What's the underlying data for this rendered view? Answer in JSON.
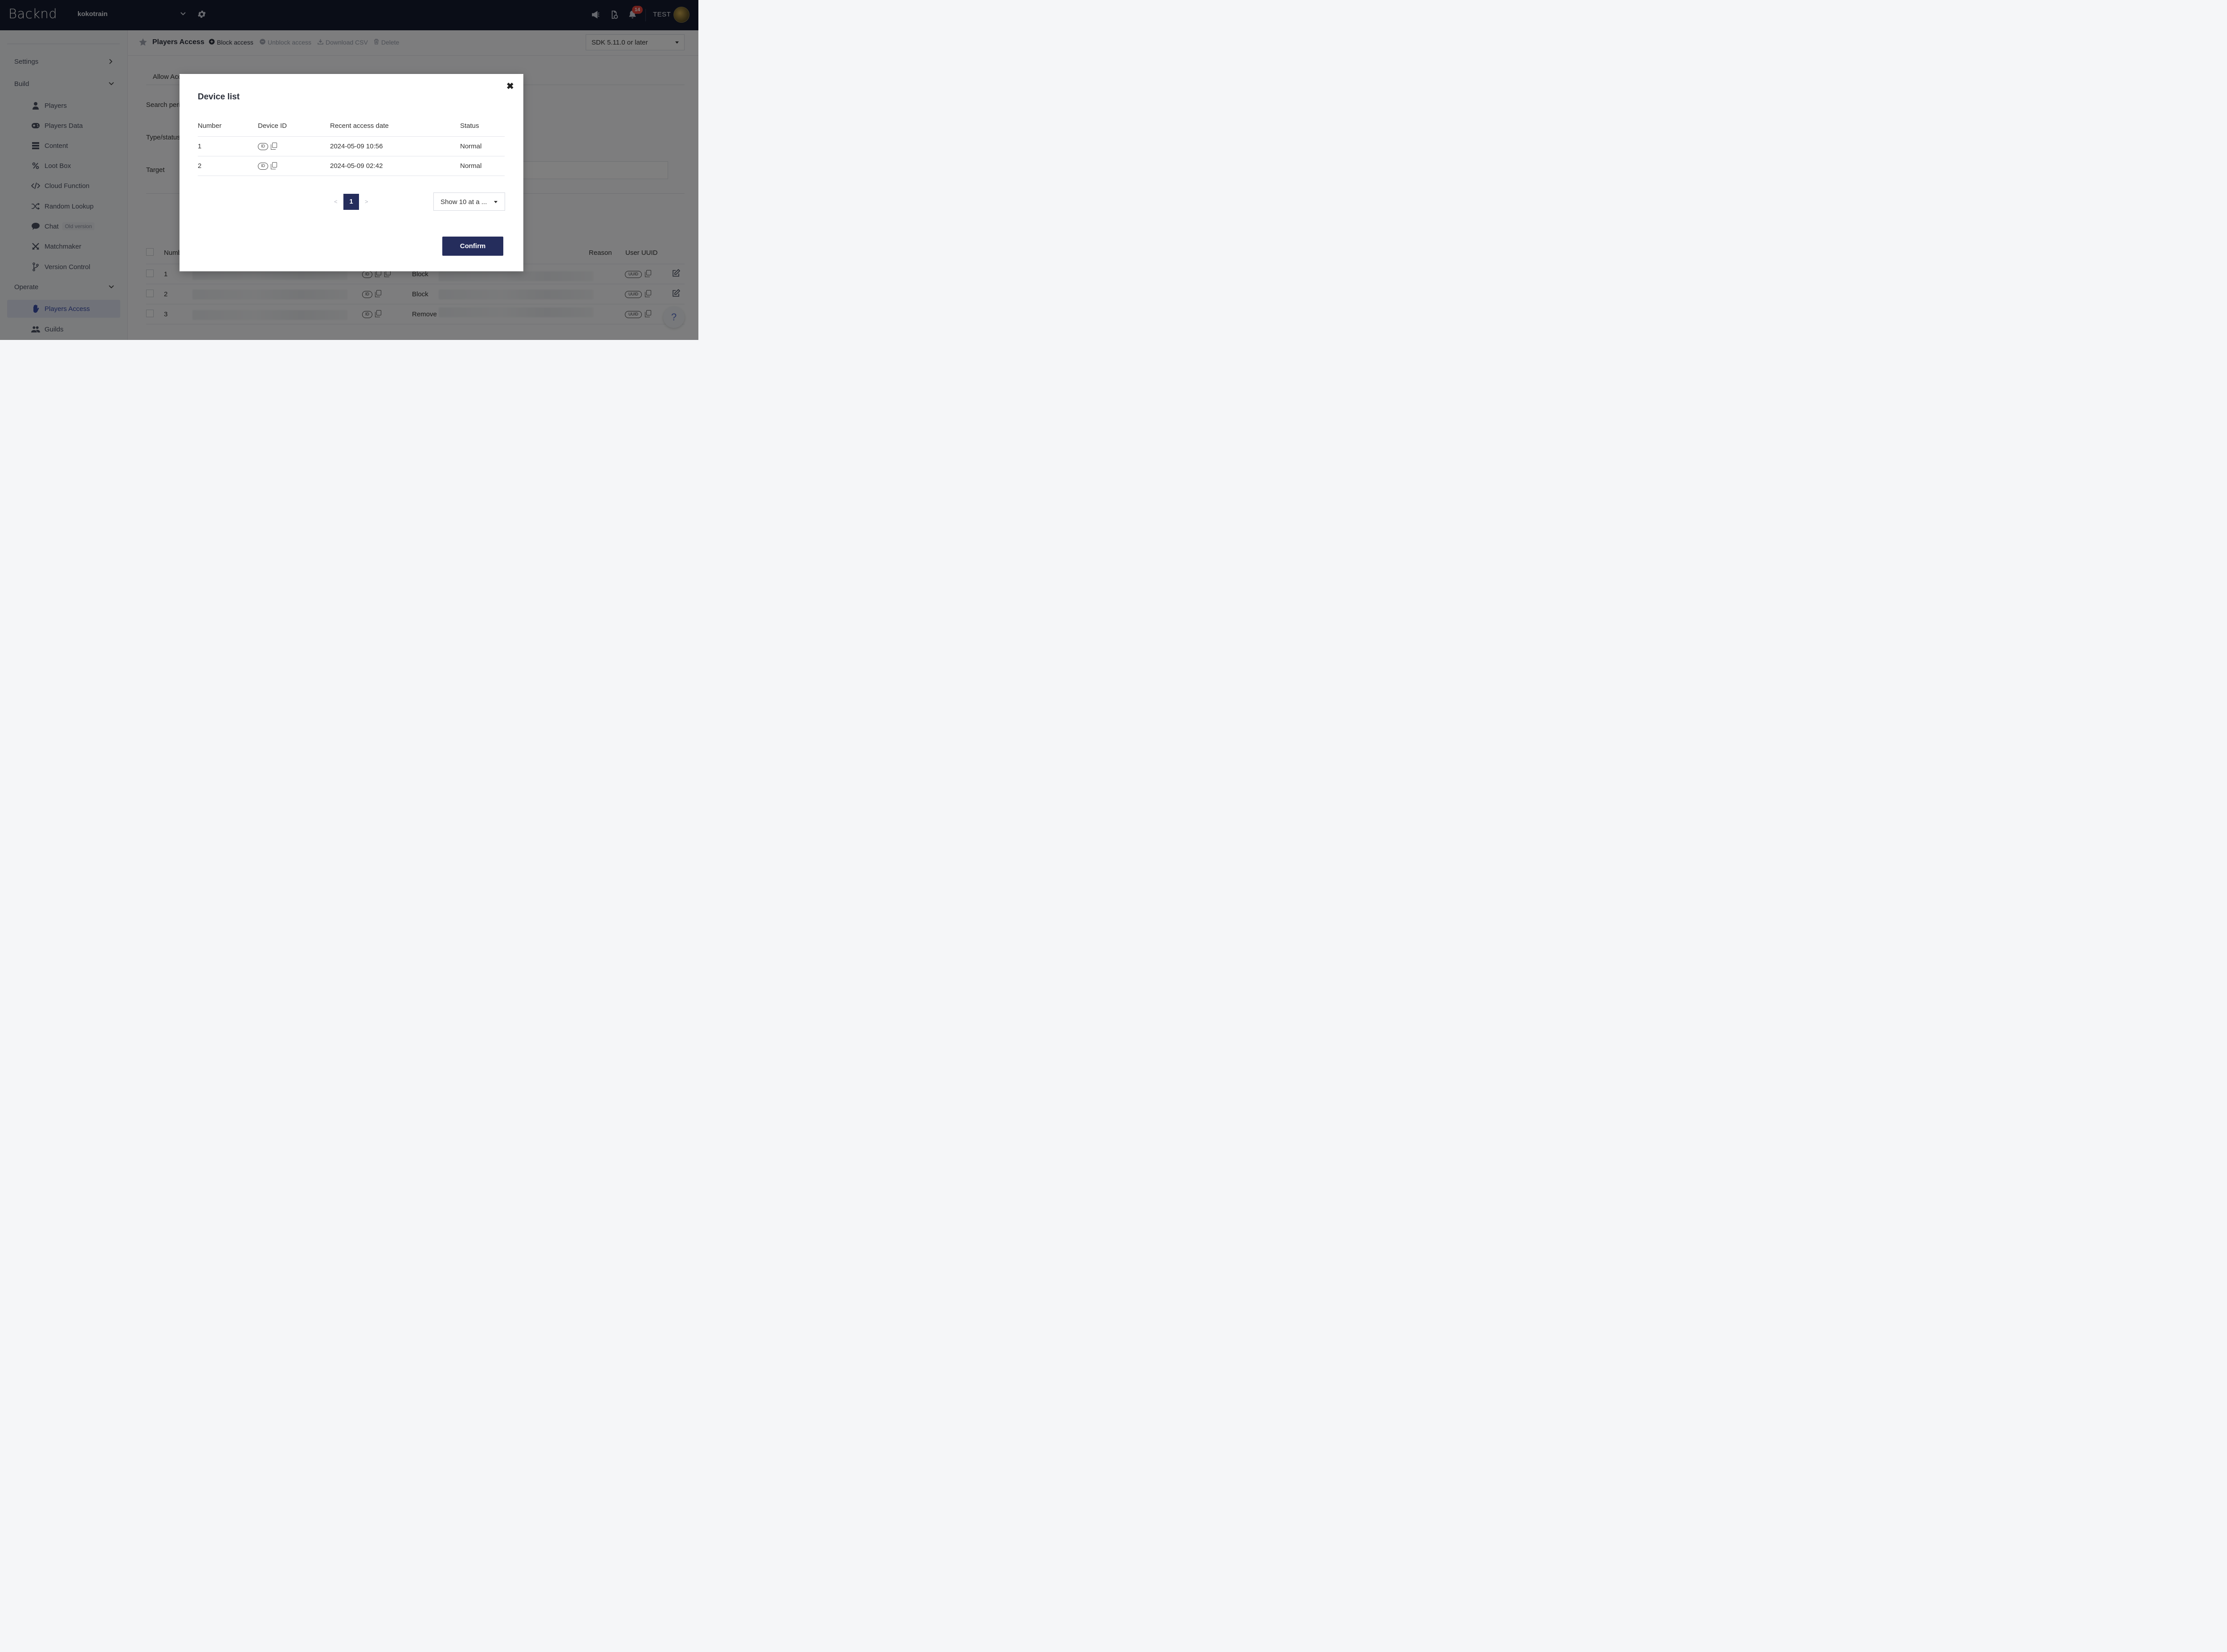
{
  "header": {
    "logo": "Backnd",
    "project": "kokotrain",
    "notification_count": "14",
    "user": "TEST"
  },
  "sidebar": {
    "sections": {
      "settings": "Settings",
      "build": "Build",
      "operate": "Operate"
    },
    "build_items": [
      {
        "label": "Players",
        "icon": "person-icon"
      },
      {
        "label": "Players Data",
        "icon": "gamepad-icon"
      },
      {
        "label": "Content",
        "icon": "server-icon"
      },
      {
        "label": "Loot Box",
        "icon": "percent-icon"
      },
      {
        "label": "Cloud Function",
        "icon": "code-icon"
      },
      {
        "label": "Random Lookup",
        "icon": "shuffle-icon"
      },
      {
        "label": "Chat",
        "icon": "chat-icon",
        "tag": "Old version"
      },
      {
        "label": "Matchmaker",
        "icon": "swords-icon"
      },
      {
        "label": "Version Control",
        "icon": "branch-icon"
      }
    ],
    "operate_items": [
      {
        "label": "Players Access",
        "icon": "hand-icon",
        "active": true
      },
      {
        "label": "Guilds",
        "icon": "users-icon"
      }
    ]
  },
  "toolbar": {
    "title": "Players Access",
    "block": "Block access",
    "unblock": "Unblock access",
    "download": "Download CSV",
    "delete": "Delete",
    "sdk": "SDK 5.11.0 or later"
  },
  "background": {
    "tab_allow": "Allow Acc",
    "search_period": "Search perio",
    "type_status": "Type/status",
    "target": "Target",
    "table_headers": {
      "number": "Numb",
      "reason": "Reason",
      "user_uuid": "User UUID"
    },
    "rows": [
      {
        "number": "1",
        "action": "Block"
      },
      {
        "number": "2",
        "action": "Block"
      },
      {
        "number": "3",
        "action": "Remove"
      }
    ],
    "id_pill": "ID",
    "uuid_pill": "UUID",
    "help": "?"
  },
  "modal": {
    "title": "Device list",
    "close": "✖",
    "headers": {
      "number": "Number",
      "device_id": "Device ID",
      "recent": "Recent access date",
      "status": "Status"
    },
    "rows": [
      {
        "number": "1",
        "id_pill": "ID",
        "date": "2024-05-09 10:56",
        "status": "Normal"
      },
      {
        "number": "2",
        "id_pill": "ID",
        "date": "2024-05-09 02:42",
        "status": "Normal"
      }
    ],
    "pagination": {
      "prev": "<",
      "current": "1",
      "next": ">"
    },
    "page_size": "Show 10 at a ...",
    "confirm": "Confirm"
  },
  "colors": {
    "topbar": "#141a2e",
    "accent": "#252d5c",
    "badge": "#e0423a",
    "active_item": "#3b4ea8"
  }
}
